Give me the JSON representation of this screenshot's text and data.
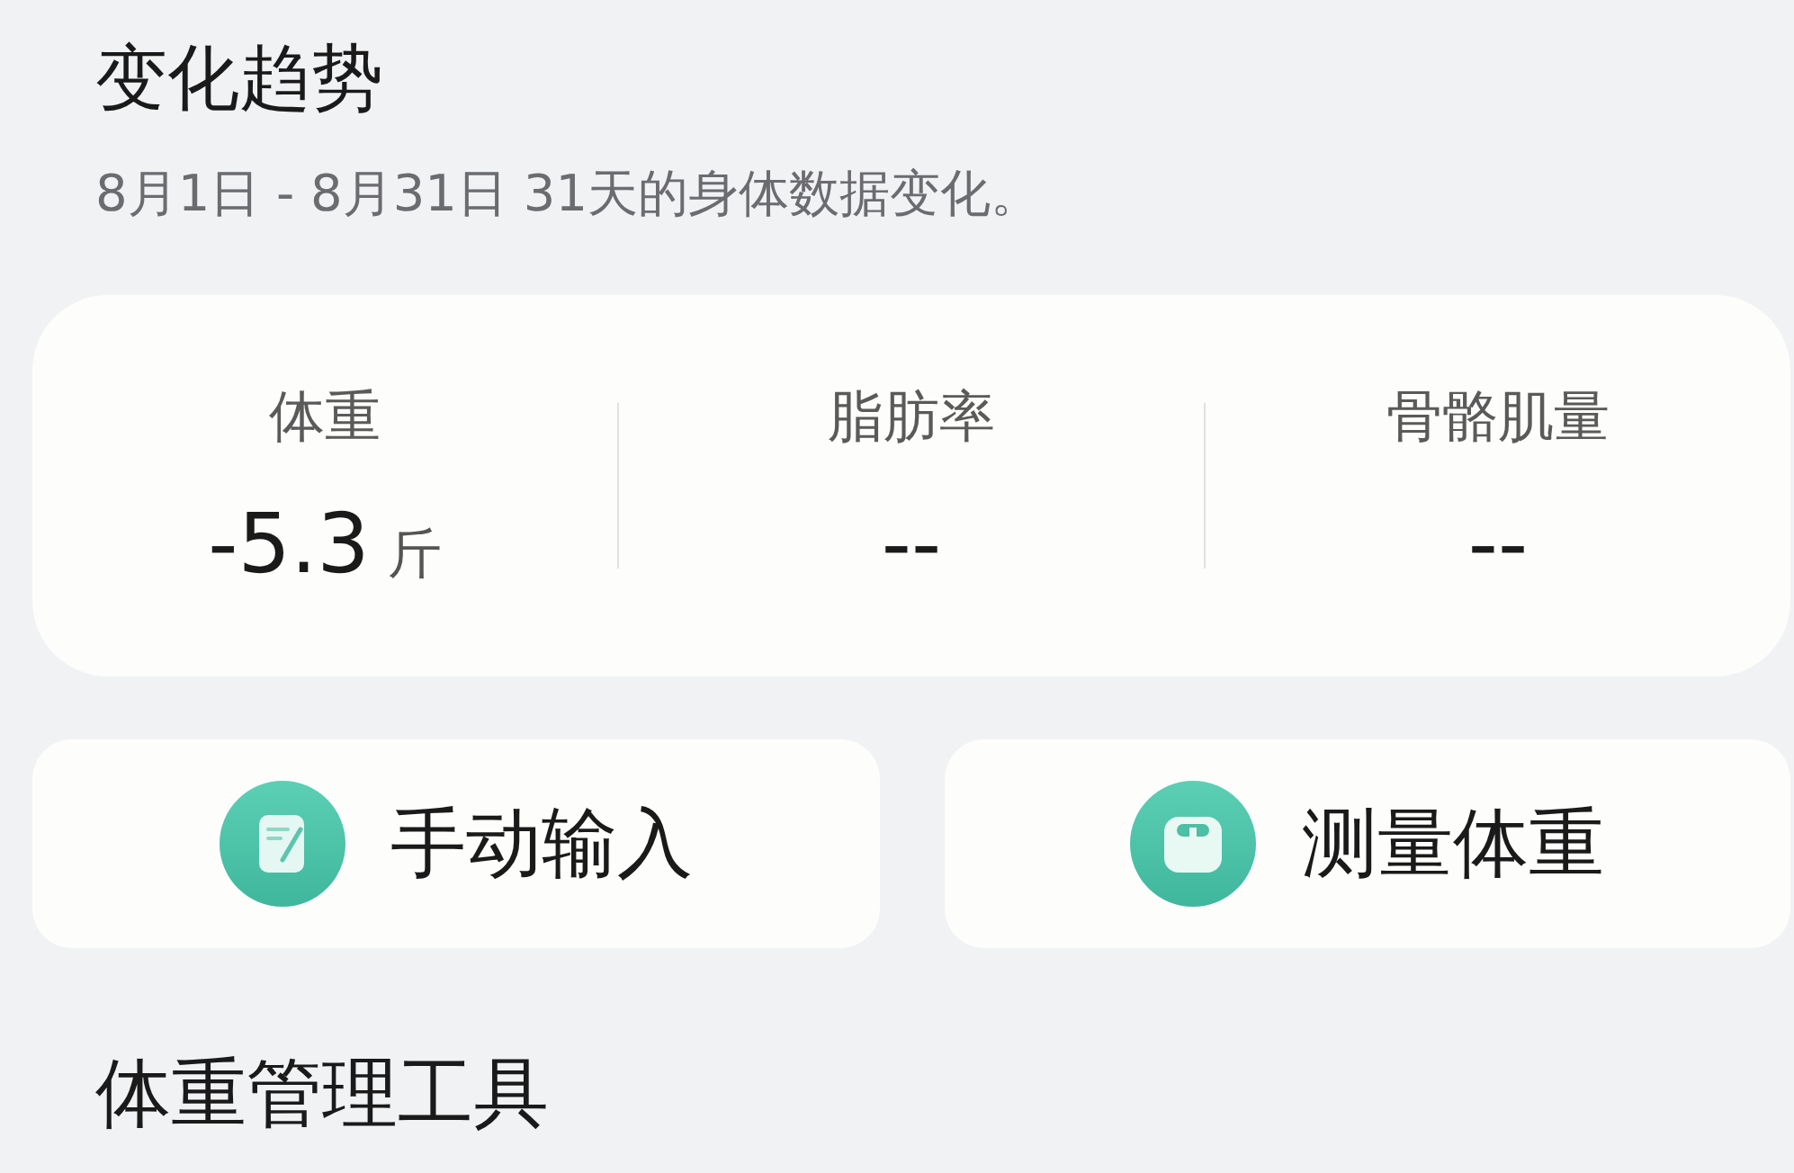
{
  "header": {
    "title": "变化趋势",
    "subtitle": "8月1日 - 8月31日 31天的身体数据变化。"
  },
  "stats": [
    {
      "label": "体重",
      "value": "-5.3",
      "unit": "斤"
    },
    {
      "label": "脂肪率",
      "value": "--"
    },
    {
      "label": "骨骼肌量",
      "value": "--"
    }
  ],
  "actions": [
    {
      "label": "手动输入",
      "kind": "note"
    },
    {
      "label": "测量体重",
      "kind": "scale"
    }
  ],
  "section": {
    "title": "体重管理工具"
  }
}
